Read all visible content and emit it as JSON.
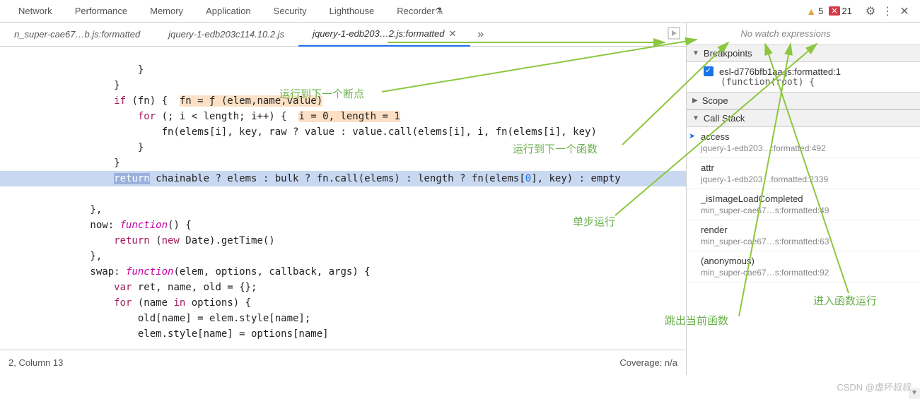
{
  "top_tabs": {
    "items": [
      "Network",
      "Performance",
      "Memory",
      "Application",
      "Security",
      "Lighthouse",
      "Recorder"
    ],
    "warn_count": "5",
    "err_count": "21"
  },
  "file_tabs": {
    "items": [
      {
        "label": "n_super-cae67…b.js:formatted",
        "active": false
      },
      {
        "label": "jquery-1-edb203c114.10.2.js",
        "active": false
      },
      {
        "label": "jquery-1-edb203…2.js:formatted",
        "active": true
      }
    ]
  },
  "code": {
    "l1": "                }",
    "l2": "            }",
    "l3_a": "            if",
    "l3_b": " (fn) {  ",
    "l3_hl": "fn = ƒ (elem,name,value)",
    "l4_a": "                for",
    "l4_b": " (; i < length; i++) {  ",
    "l4_hl": "i = 0, length = 1",
    "l5_a": "                    fn(elems[i], key, raw ? value : value.call(elems[i], i, fn(elems[i], key)",
    "l6": "                }",
    "l7": "            }",
    "l8_a": "            ",
    "l8_ret": "return",
    "l8_b": " chainable ? elems : bulk ? fn.call(elems) : length ? fn(elems[",
    "l8_num": "0",
    "l8_c": "], key) : empty",
    "l9": "        },",
    "l10_a": "        now: ",
    "l10_fn": "function",
    "l10_b": "() {",
    "l11_a": "            return",
    "l11_b": " (",
    "l11_new": "new",
    "l11_c": " Date).getTime()",
    "l12": "        },",
    "l13_a": "        swap: ",
    "l13_fn": "function",
    "l13_b": "(elem, options, callback, args) {",
    "l14_a": "            var",
    "l14_b": " ret, name, old = {};",
    "l15_a": "            for",
    "l15_b": " (name ",
    "l15_in": "in",
    "l15_c": " options) {",
    "l16": "                old[name] = elem.style[name];",
    "l17": "                elem.style[name] = options[name]"
  },
  "status": {
    "left": "2, Column 13",
    "right": "Coverage: n/a"
  },
  "right": {
    "watch_msg": "No watch expressions",
    "breakpoints_hdr": "Breakpoints",
    "bp_file": "esl-d776bfb1aa.js:formatted:1",
    "bp_code": "(function(root) {",
    "scope_hdr": "Scope",
    "callstack_hdr": "Call Stack",
    "stack": [
      {
        "fn": "access",
        "loc": "jquery-1-edb203…:formatted:492"
      },
      {
        "fn": "attr",
        "loc": "jquery-1-edb203…formatted:2339"
      },
      {
        "fn": "_isImageLoadCompleted",
        "loc": "min_super-cae67…s:formatted:49"
      },
      {
        "fn": "render",
        "loc": "min_super-cae67…s:formatted:63"
      },
      {
        "fn": "(anonymous)",
        "loc": "min_super-cae67…s:formatted:92"
      }
    ]
  },
  "annotations": {
    "a1": "运行到下一个断点",
    "a2": "运行到下一个函数",
    "a3": "单步运行",
    "a4": "跳出当前函数",
    "a5": "进入函数运行"
  },
  "watermark": "CSDN @虚坏叔叔"
}
